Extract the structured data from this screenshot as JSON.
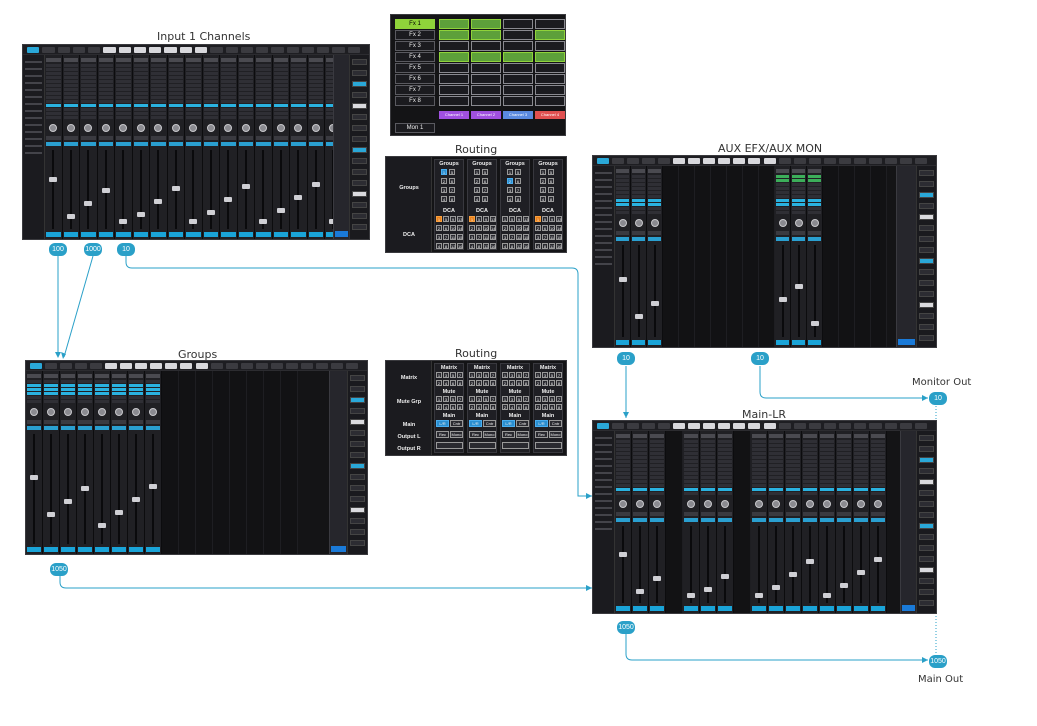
{
  "panels": {
    "input": {
      "title": "Input 1 Channels"
    },
    "aux": {
      "title": "AUX EFX/AUX MON"
    },
    "groups": {
      "title": "Groups"
    },
    "main": {
      "title": "Main-LR"
    },
    "routing_a": {
      "title": "Routing",
      "row_labels": [
        "Groups",
        "DCA"
      ],
      "col_labels_top": [
        "Groups",
        "Groups",
        "Groups",
        "Groups"
      ],
      "col_labels_bottom": [
        "DCA",
        "DCA",
        "DCA",
        "DCA"
      ]
    },
    "routing_b": {
      "title": "Routing",
      "row_labels": [
        "Matrix",
        "Mute Grp",
        "Main",
        "Output L",
        "Output R"
      ],
      "col_labels_matrix": [
        "Matrix",
        "Matrix",
        "Matrix",
        "Matrix"
      ],
      "col_labels_mute": [
        "Mute",
        "Mute",
        "Mute",
        "Mute"
      ],
      "col_labels_main": [
        "Main",
        "Main",
        "Main",
        "Main"
      ],
      "lr_label": "L/R",
      "cntr_label": "Cntr",
      "rec_label": "Rec",
      "mono_label": "Mono"
    },
    "fx": {
      "buttons": [
        "Fx 1",
        "Fx 2",
        "Fx 3",
        "Fx 4",
        "Fx 5",
        "Fx 6",
        "Fx 7",
        "Fx 8"
      ],
      "mon_button": "Mon 1",
      "channels": [
        "Channel 1",
        "Channel 2",
        "Channel 3",
        "Channel 4"
      ],
      "channel_colors": [
        "#a050e0",
        "#a050e0",
        "#5a8ae0",
        "#e05050"
      ]
    }
  },
  "outputs": {
    "monitor": "Monitor Out",
    "main": "Main Out"
  },
  "badges": {
    "input_a": "100",
    "input_b": "1000",
    "input_c": "10",
    "aux_a": "10",
    "aux_b": "10",
    "groups": "1050",
    "main": "1050",
    "monitor": "10",
    "mainout": "1050"
  },
  "colors": {
    "accent": "#2aa0c8",
    "green": "#8fd33a",
    "orange": "#e8801a"
  }
}
